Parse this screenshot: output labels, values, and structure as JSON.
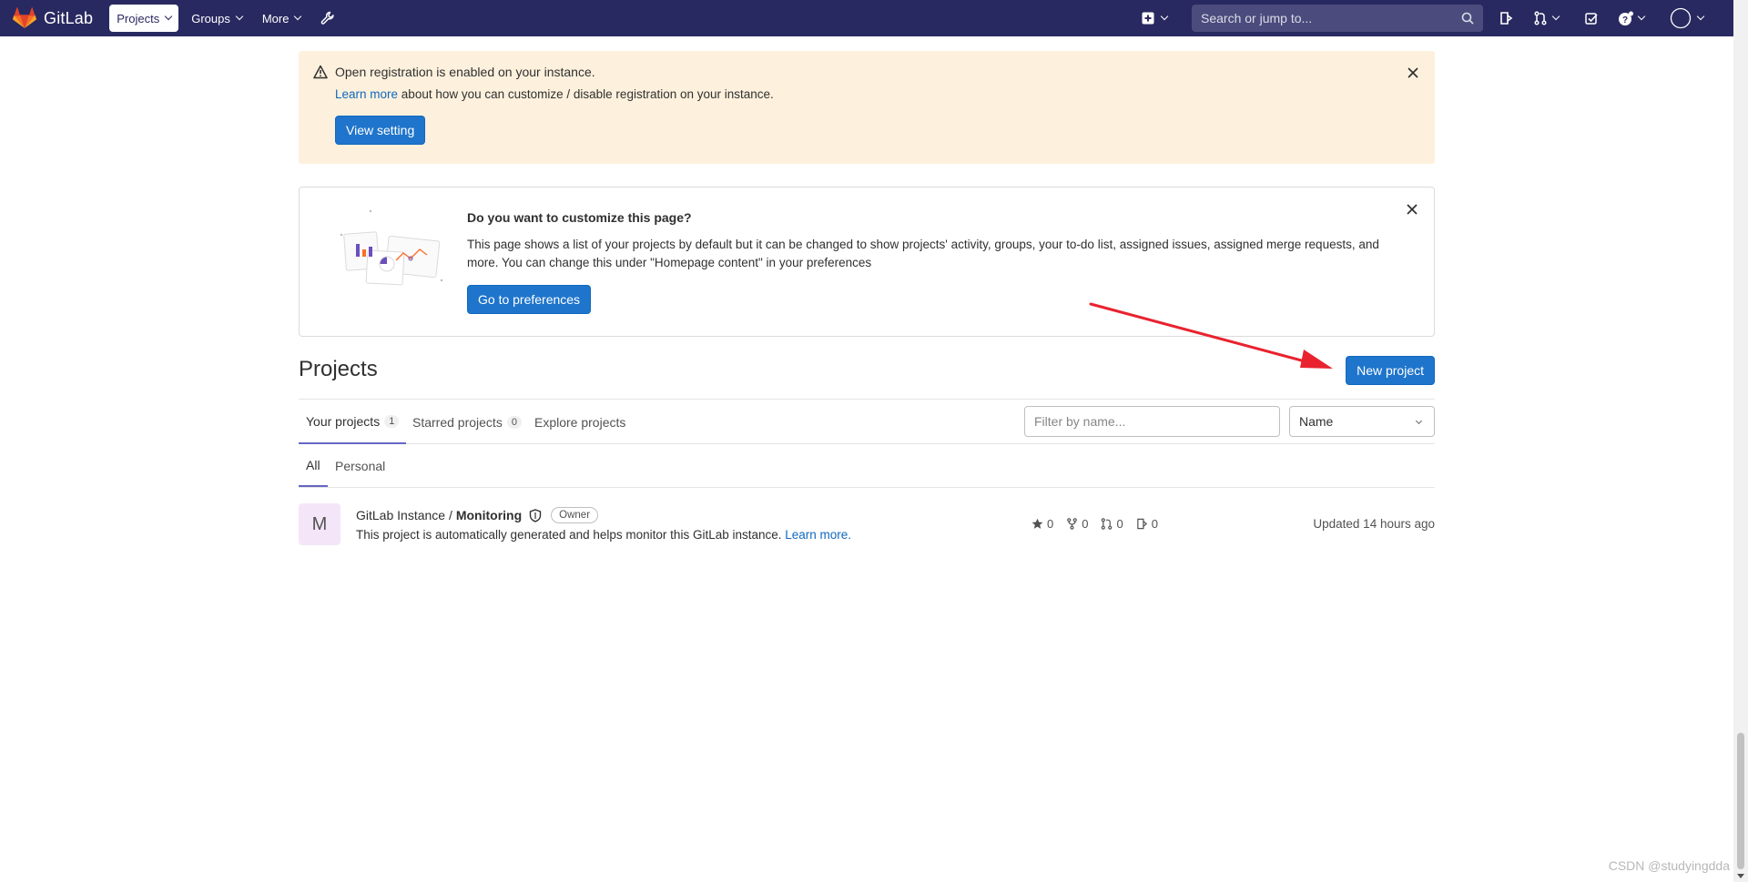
{
  "navbar": {
    "brand": "GitLab",
    "items": [
      {
        "label": "Projects"
      },
      {
        "label": "Groups"
      },
      {
        "label": "More"
      }
    ],
    "search_placeholder": "Search or jump to...",
    "icons": [
      "admin-wrench-icon",
      "plus-square-icon",
      "search-icon",
      "issues-icon",
      "merge-request-icon",
      "todo-icon",
      "help-icon",
      "user-avatar-icon"
    ],
    "background": "#292961"
  },
  "registration_alert": {
    "title": "Open registration is enabled on your instance.",
    "link": "Learn more",
    "body_rest": " about how you can customize / disable registration on your instance.",
    "button": "View setting",
    "background": "#fdf1dd"
  },
  "customize_card": {
    "title": "Do you want to customize this page?",
    "body": "This page shows a list of your projects by default but it can be changed to show projects' activity, groups, your to-do list, assigned issues, assigned merge requests, and more. You can change this under \"Homepage content\" in your preferences",
    "button": "Go to preferences"
  },
  "projects": {
    "title": "Projects",
    "new_button": "New project",
    "tabs": [
      {
        "label": "Your projects",
        "count": "1"
      },
      {
        "label": "Starred projects",
        "count": "0"
      },
      {
        "label": "Explore projects"
      }
    ],
    "filter_placeholder": "Filter by name...",
    "sort_value": "Name",
    "subtabs": [
      "All",
      "Personal"
    ],
    "list": [
      {
        "avatar_letter": "M",
        "namespace": "GitLab Instance /",
        "name": "Monitoring",
        "role": "Owner",
        "description": "This project is automatically generated and helps monitor this GitLab instance.",
        "description_link": "Learn more.",
        "stars": "0",
        "forks": "0",
        "merge_requests": "0",
        "issues": "0",
        "updated": "Updated 14 hours ago"
      }
    ]
  },
  "colors": {
    "primary_button": "#1f75cb",
    "link": "#1068bf",
    "tab_active_border": "#6666c4",
    "annotation_arrow": "#e8232f"
  },
  "watermark": "CSDN @studyingdda"
}
